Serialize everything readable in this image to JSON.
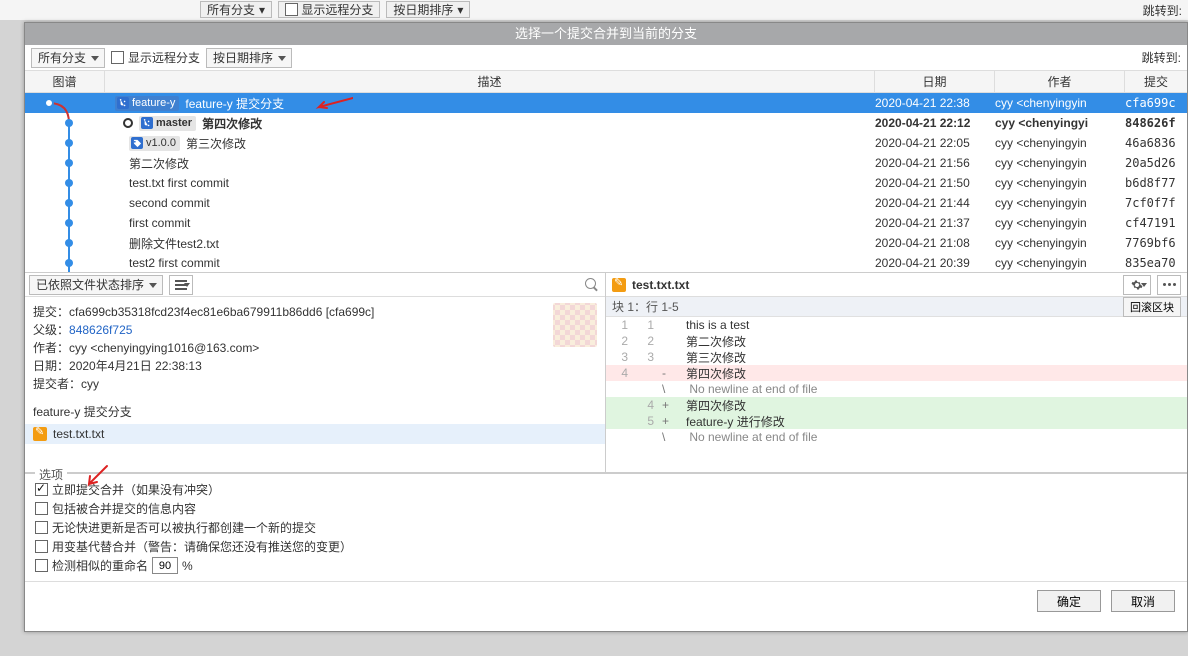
{
  "bg": {
    "all_branches": "所有分支",
    "show_remote": "显示远程分支",
    "sort": "按日期排序",
    "jump": "跳转到:"
  },
  "dialog_title": "选择一个提交合并到当前的分支",
  "toolbar": {
    "branch_filter": "所有分支",
    "show_remote": "显示远程分支",
    "sort": "按日期排序",
    "jump": "跳转到:"
  },
  "headers": {
    "graph": "图谱",
    "desc": "描述",
    "date": "日期",
    "author": "作者",
    "commit": "提交"
  },
  "tags": {
    "feature_y": "feature-y",
    "master": "master",
    "v100": "v1.0.0"
  },
  "commits": [
    {
      "msg": "feature-y 提交分支",
      "date": "2020-04-21 22:38",
      "auth": "cyy <chenyingyin",
      "hash": "cfa699c"
    },
    {
      "msg": "第四次修改",
      "date": "2020-04-21 22:12",
      "auth": "cyy <chenyingyi",
      "hash": "848626f"
    },
    {
      "msg": "第三次修改",
      "date": "2020-04-21 22:05",
      "auth": "cyy <chenyingyin",
      "hash": "46a6836"
    },
    {
      "msg": "第二次修改",
      "date": "2020-04-21 21:56",
      "auth": "cyy <chenyingyin",
      "hash": "20a5d26"
    },
    {
      "msg": "test.txt first commit",
      "date": "2020-04-21 21:50",
      "auth": "cyy <chenyingyin",
      "hash": "b6d8f77"
    },
    {
      "msg": "second commit",
      "date": "2020-04-21 21:44",
      "auth": "cyy <chenyingyin",
      "hash": "7cf0f7f"
    },
    {
      "msg": "first commit",
      "date": "2020-04-21 21:37",
      "auth": "cyy <chenyingyin",
      "hash": "cf47191"
    },
    {
      "msg": "删除文件test2.txt",
      "date": "2020-04-21 21:08",
      "auth": "cyy <chenyingyin",
      "hash": "7769bf6"
    },
    {
      "msg": "test2 first commit",
      "date": "2020-04-21 20:39",
      "auth": "cyy <chenyingyin",
      "hash": "835ea70"
    }
  ],
  "sort_dropdown": "已依照文件状态排序",
  "info": {
    "l_commit": "提交：",
    "v_commit": "cfa699cb35318fcd23f4ec81e6ba679911b86dd6 [cfa699c]",
    "l_parent": "父级：",
    "v_parent": "848626f725",
    "l_author": "作者：",
    "v_author": "cyy <chenyingying1016@163.com>",
    "l_date": "日期：",
    "v_date": "2020年4月21日 22:38:13",
    "l_committer": "提交者：",
    "v_committer": "cyy",
    "subject": "feature-y 提交分支"
  },
  "file": "test.txt.txt",
  "diff_file": "test.txt.txt",
  "hunk": "块 1：行 1-5",
  "revert_hunk": "回滚区块",
  "diff_lines": [
    {
      "ol": "1",
      "nl": "1",
      "g": " ",
      "t": "this is a test",
      "cls": ""
    },
    {
      "ol": "2",
      "nl": "2",
      "g": " ",
      "t": "第二次修改",
      "cls": ""
    },
    {
      "ol": "3",
      "nl": "3",
      "g": " ",
      "t": "第三次修改",
      "cls": ""
    },
    {
      "ol": "4",
      "nl": "",
      "g": "-",
      "t": "第四次修改",
      "cls": "del"
    },
    {
      "ol": "",
      "nl": "",
      "g": "\\",
      "t": " No newline at end of file",
      "cls": "nonl"
    },
    {
      "ol": "",
      "nl": "4",
      "g": "+",
      "t": "第四次修改",
      "cls": "add"
    },
    {
      "ol": "",
      "nl": "5",
      "g": "+",
      "t": "feature-y 进行修改",
      "cls": "add"
    },
    {
      "ol": "",
      "nl": "",
      "g": "\\",
      "t": " No newline at end of file",
      "cls": "nonl"
    }
  ],
  "options": {
    "legend": "选项",
    "opt1": "立即提交合并（如果没有冲突）",
    "opt2": "包括被合并提交的信息内容",
    "opt3": "无论快进更新是否可以被执行都创建一个新的提交",
    "opt4": "用变基代替合并（警告：请确保您还没有推送您的变更）",
    "opt5": "检测相似的重命名",
    "pct": "90",
    "pct_sym": "%"
  },
  "footer": {
    "ok": "确定",
    "cancel": "取消"
  }
}
